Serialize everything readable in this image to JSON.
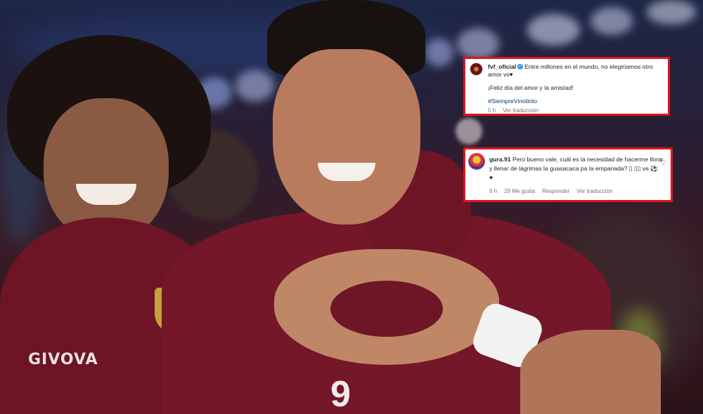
{
  "post": {
    "username": "fvf_oficial",
    "caption_line1": "Entre millones en el mundo, no elegiríamos otro",
    "caption_line2": "amor vs♥",
    "caption_line3": "¡Feliz día del amor y la amistad!",
    "hashtag": "#SiempreVinotinto",
    "time": "5 h",
    "translate": "Ver traducción"
  },
  "reply": {
    "username": "gura.91",
    "text_line1": "Pero bueno vale, cuál es la necesidad de hacerme llorar",
    "text_line2": "y llenar de lágrimas la guasacaca pa la empanada? ▯ ▯▯ ve ⚽",
    "text_line3": "♥",
    "time": "6 h",
    "likes": "29 Me gusta",
    "reply_label": "Responder",
    "translate": "Ver traducción",
    "like_icon": "♡"
  },
  "colors": {
    "card_border": "#e3121b",
    "jersey": "#6b1423",
    "verified": "#3897f0"
  }
}
